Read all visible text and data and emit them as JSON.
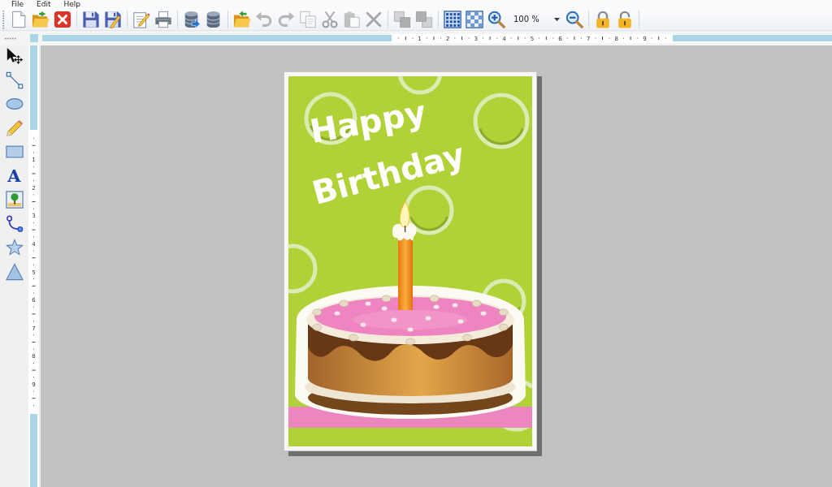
{
  "menu_bar": [
    {
      "label": "File"
    },
    {
      "label": "Edit"
    },
    {
      "label": "Help"
    }
  ],
  "toolbar": [
    {
      "kind": "new",
      "disabled": false
    },
    {
      "kind": "open",
      "disabled": false
    },
    {
      "kind": "close",
      "disabled": false
    },
    {
      "kind": "separator"
    },
    {
      "kind": "save",
      "disabled": false
    },
    {
      "kind": "save_as",
      "disabled": false
    },
    {
      "kind": "separator"
    },
    {
      "kind": "edit",
      "disabled": false
    },
    {
      "kind": "print",
      "disabled": false
    },
    {
      "kind": "separator"
    },
    {
      "kind": "database_add",
      "disabled": false
    },
    {
      "kind": "database",
      "disabled": false
    },
    {
      "kind": "separator"
    },
    {
      "kind": "import",
      "disabled": false
    },
    {
      "kind": "undo",
      "disabled": true
    },
    {
      "kind": "redo",
      "disabled": true
    },
    {
      "kind": "copy",
      "disabled": true
    },
    {
      "kind": "cut",
      "disabled": true
    },
    {
      "kind": "paste",
      "disabled": true
    },
    {
      "kind": "delete",
      "disabled": true
    },
    {
      "kind": "separator"
    },
    {
      "kind": "bring_forward",
      "disabled": true
    },
    {
      "kind": "send_backward",
      "disabled": true
    },
    {
      "kind": "separator"
    },
    {
      "kind": "grid",
      "disabled": false
    },
    {
      "kind": "checker",
      "disabled": false
    },
    {
      "kind": "zoom_in",
      "disabled": false
    },
    {
      "kind": "zoom_field",
      "value": "100 %"
    },
    {
      "kind": "zoom_out",
      "disabled": false
    },
    {
      "kind": "separator"
    },
    {
      "kind": "lock",
      "disabled": false
    },
    {
      "kind": "unlock",
      "disabled": false
    },
    {
      "kind": "separator"
    }
  ],
  "tool_palette": [
    {
      "kind": "select"
    },
    {
      "kind": "line"
    },
    {
      "kind": "ellipse"
    },
    {
      "kind": "pencil"
    },
    {
      "kind": "rectangle"
    },
    {
      "kind": "text",
      "glyph": "A"
    },
    {
      "kind": "image"
    },
    {
      "kind": "curve"
    },
    {
      "kind": "star"
    },
    {
      "kind": "triangle"
    }
  ],
  "rulers": {
    "horizontal": [
      "1",
      "2",
      "3",
      "4",
      "5",
      "6",
      "7",
      "8",
      "9"
    ],
    "vertical": [
      "1",
      "2",
      "3",
      "4",
      "5",
      "6",
      "7",
      "8",
      "9"
    ]
  },
  "card": {
    "title_lines": [
      "Happy",
      "Birthday"
    ]
  }
}
